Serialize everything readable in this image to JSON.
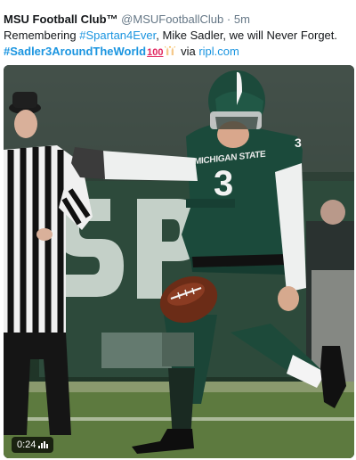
{
  "tweet": {
    "display_name": "MSU Football Club™",
    "handle": "@MSUFootballClub",
    "separator": "·",
    "time": "5m",
    "text_part1": "Remembering ",
    "hashtag1": "#Spartan4Ever",
    "text_part2": ", Mike Sadler, we will Never Forget.",
    "hashtag2": "#Sadler3AroundTheWorld",
    "emoji_100": "100",
    "via_label": " via ",
    "via_link": "ripl.com"
  },
  "media": {
    "jersey_text": "MICHIGAN STATE",
    "jersey_number": "3",
    "video_duration": "0:24",
    "colors": {
      "spartan_green": "#18453b",
      "link_blue": "#1b95e0"
    }
  },
  "icons": {
    "hands": "raised-hands-icon",
    "volume": "volume-bars-icon"
  }
}
